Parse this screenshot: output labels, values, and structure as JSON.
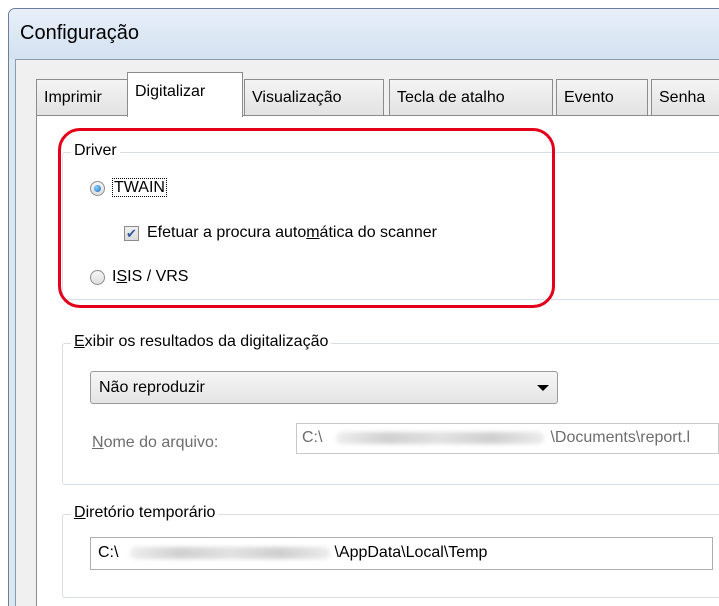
{
  "window": {
    "title": "Configuração"
  },
  "tabs": [
    {
      "label": "Imprimir",
      "active": false
    },
    {
      "label": "Digitalizar",
      "active": true
    },
    {
      "label": "Visualização",
      "active": false
    },
    {
      "label": "Tecla de atalho",
      "active": false
    },
    {
      "label": "Evento",
      "active": false
    },
    {
      "label": "Senha",
      "active": false
    }
  ],
  "driver": {
    "legend": "Driver",
    "twain_label": "TWAIN",
    "twain_selected": true,
    "auto_search_prefix": "Efetuar a procura auto",
    "auto_search_mnemonic": "m",
    "auto_search_suffix": "ática do scanner",
    "auto_search_checked": true,
    "isis_prefix": "I",
    "isis_mnemonic": "S",
    "isis_suffix": "IS / VRS",
    "isis_selected": false
  },
  "results": {
    "legend_mnemonic": "E",
    "legend_rest": "xibir os resultados da digitalização",
    "dropdown_value": "Não reproduzir",
    "filename_label_mnemonic": "N",
    "filename_label_rest": "ome do arquivo:",
    "filename_prefix": "C:\\",
    "filename_suffix": "\\Documents\\report.l"
  },
  "temp": {
    "legend_mnemonic": "D",
    "legend_rest": "iretório temporário",
    "path_prefix": "C:\\",
    "path_suffix": "\\AppData\\Local\\Temp"
  },
  "colors": {
    "highlight": "#e2001a",
    "radio_dot": "#1d6bbd",
    "title_bar": "#dce7f4"
  },
  "icons": {
    "dropdown_arrow": "chevron-down-icon",
    "checkbox_check": "check-icon"
  }
}
